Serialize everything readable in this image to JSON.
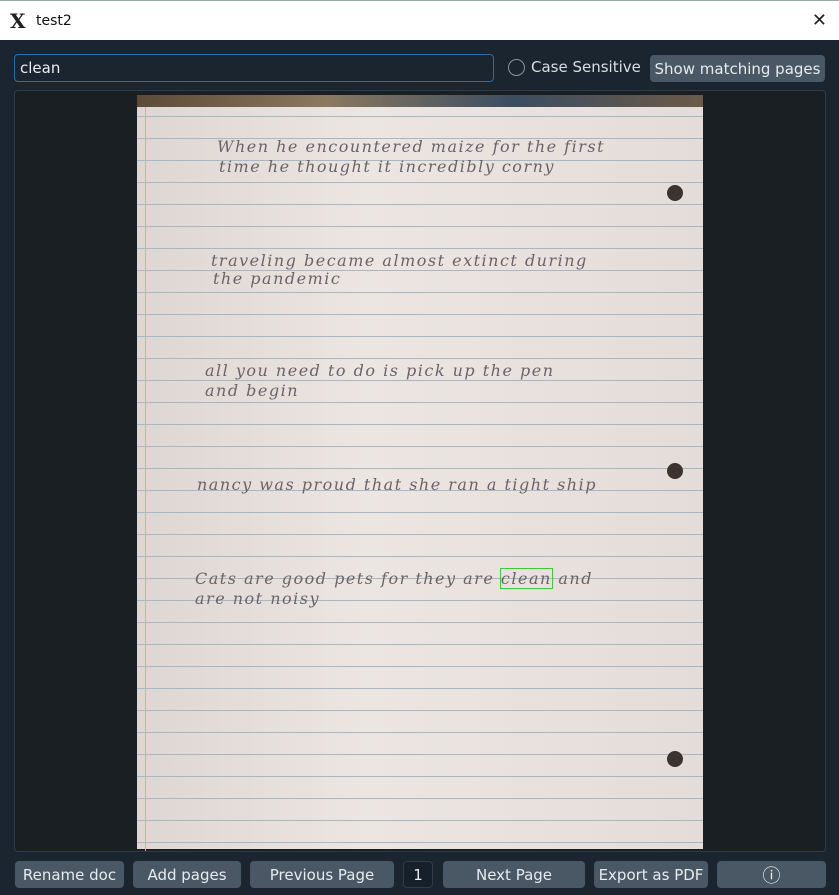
{
  "window": {
    "title": "test2"
  },
  "search": {
    "value": "clean",
    "case_label": "Case Sensitive",
    "show_label": "Show matching pages"
  },
  "page": {
    "lines": [
      {
        "l1": "When he encountered maize for the first",
        "l2": "time he thought it incredibly corny"
      },
      {
        "l1": "traveling became almost extinct during",
        "l2": "the pandemic"
      },
      {
        "l1": "all you need to do is pick up the pen",
        "l2": "and begin"
      },
      {
        "l1": "nancy was proud that she ran a tight ship",
        "l2": ""
      },
      {
        "l1a": "Cats are good pets for they are",
        "match": "clean",
        "l1b": "and",
        "l2": "are not noisy"
      }
    ]
  },
  "toolbar": {
    "rename": "Rename doc",
    "add": "Add pages",
    "prev": "Previous Page",
    "page_number": "1",
    "next": "Next Page",
    "export": "Export as PDF",
    "info_icon": "ⓘ"
  }
}
